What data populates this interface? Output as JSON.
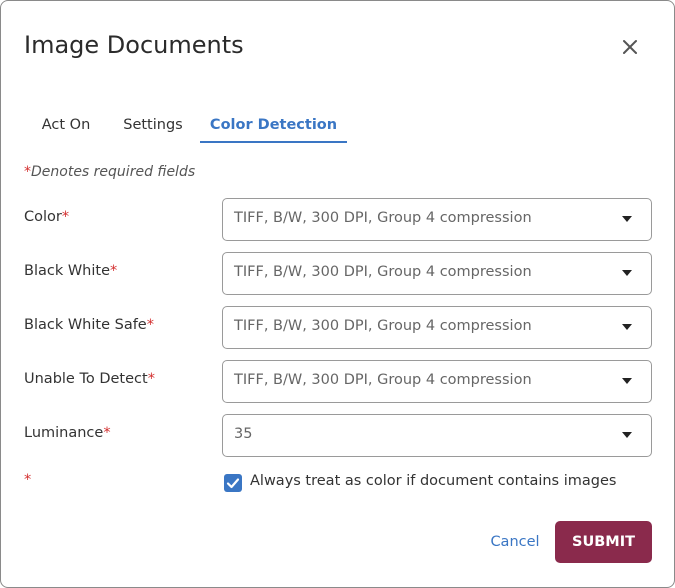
{
  "dialog": {
    "title": "Image Documents"
  },
  "tabs": [
    {
      "label": "Act On",
      "active": false
    },
    {
      "label": "Settings",
      "active": false
    },
    {
      "label": "Color Detection",
      "active": true
    }
  ],
  "required_note": {
    "star": "*",
    "text": "Denotes required fields"
  },
  "fields": [
    {
      "label": "Color",
      "star": "*",
      "value": "TIFF, B/W, 300 DPI, Group 4 compression"
    },
    {
      "label": "Black White",
      "star": "*",
      "value": "TIFF, B/W, 300 DPI, Group 4 compression"
    },
    {
      "label": "Black White Safe",
      "star": "*",
      "value": "TIFF, B/W, 300 DPI, Group 4 compression"
    },
    {
      "label": "Unable To Detect",
      "star": "*",
      "value": "TIFF, B/W, 300 DPI, Group 4 compression"
    },
    {
      "label": "Luminance",
      "star": "*",
      "value": "35"
    }
  ],
  "checkbox_row": {
    "star": "*",
    "checked": true,
    "label": "Always treat as color if document contains images"
  },
  "footer": {
    "cancel_label": "Cancel",
    "submit_label": "SUBMIT"
  },
  "colors": {
    "accent": "#3a76c4",
    "submit": "#8a2a4c",
    "required": "#d32f2f"
  },
  "icons": {
    "close": "close-icon",
    "dropdown": "caret-down-icon",
    "check": "checkmark-icon"
  }
}
